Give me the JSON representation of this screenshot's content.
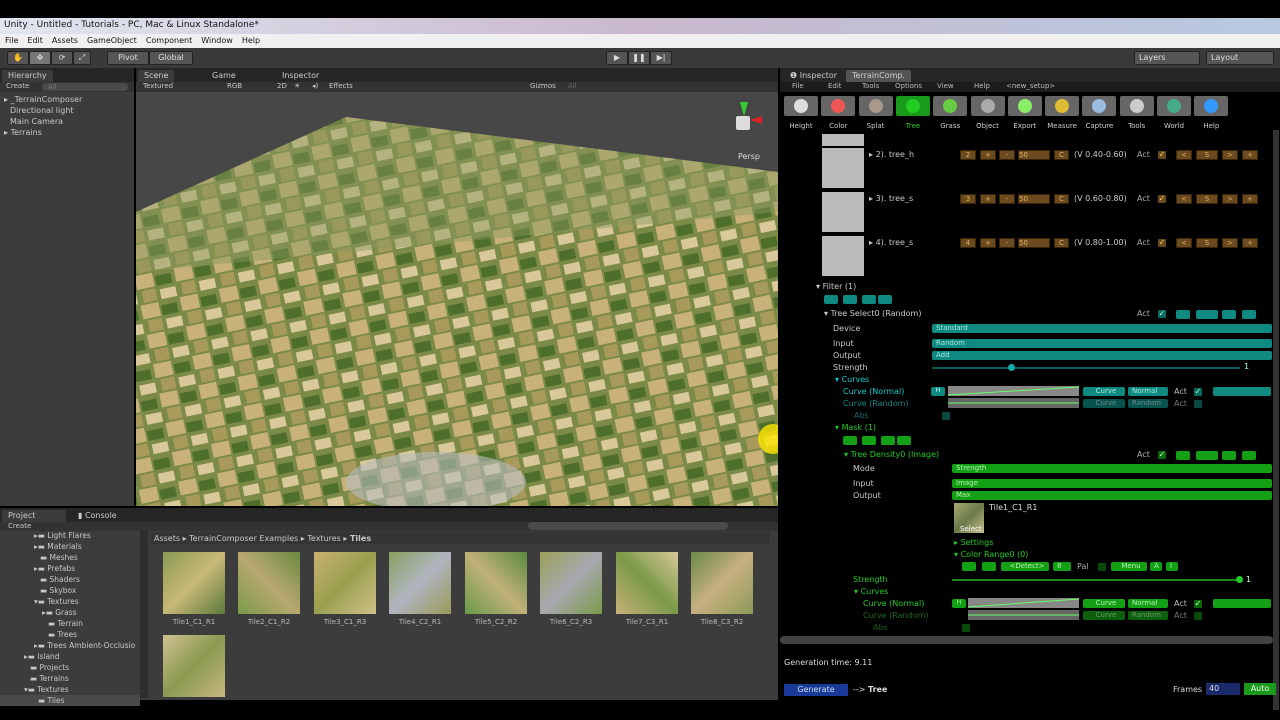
{
  "window": {
    "title": "Unity - Untitled - Tutorials - PC, Mac & Linux Standalone*"
  },
  "menu": [
    "File",
    "Edit",
    "Assets",
    "GameObject",
    "Component",
    "Window",
    "Help"
  ],
  "toolbar": {
    "pivot": "Pivot",
    "global": "Global",
    "layers": "Layers",
    "layout": "Layout"
  },
  "hierarchy": {
    "tab": "Hierarchy",
    "create": "Create",
    "search": "All",
    "items": [
      "_TerrainComposer",
      "Directional light",
      "Main Camera",
      "Terrains"
    ]
  },
  "scene": {
    "tabs": [
      "Scene",
      "Game",
      "Inspector"
    ],
    "shading": "Textured",
    "rgb": "RGB",
    "mode2d": "2D",
    "effects": "Effects",
    "gizmos": "Gizmos",
    "search": "All",
    "persp": "Persp"
  },
  "project": {
    "tabs": [
      "Project",
      "Console"
    ],
    "create": "Create",
    "folders": [
      "Light Flares",
      "Materials",
      "Meshes",
      "Prefabs",
      "Shaders",
      "Skybox",
      "Textures",
      "Grass",
      "Terrain",
      "Trees",
      "Trees Ambient-Occlusio",
      "Island",
      "Projects",
      "Terrains",
      "Textures",
      "Tiles"
    ],
    "breadcrumb": [
      "Assets",
      "TerrainComposer Examples",
      "Textures",
      "Tiles"
    ],
    "assets": [
      "Tile1_C1_R1",
      "Tile2_C1_R2",
      "Tile3_C1_R3",
      "Tile4_C2_R1",
      "Tile5_C2_R2",
      "Tile6_C2_R3",
      "Tile7_C3_R1",
      "Tile8_C3_R2"
    ]
  },
  "tc": {
    "tabs": [
      "Inspector",
      "TerrainComp."
    ],
    "menu": [
      "File",
      "Edit",
      "Tools",
      "Options",
      "View",
      "Help",
      "<new_setup>"
    ],
    "modes": [
      "Height",
      "Color",
      "Splat",
      "Tree",
      "Grass",
      "Object",
      "Export",
      "Measure",
      "Capture",
      "Tools",
      "World",
      "Help"
    ],
    "trees": [
      {
        "name": "2). tree_h",
        "idx": "2",
        "val": "50",
        "range": "(V 0.40-0.60)"
      },
      {
        "name": "3). tree_s",
        "idx": "3",
        "val": "50",
        "range": "(V 0.60-0.80)"
      },
      {
        "name": "4). tree_s",
        "idx": "4",
        "val": "50",
        "range": "(V 0.80-1.00)"
      }
    ],
    "act": "Act",
    "filter": {
      "title": "Filter (1)",
      "select": "Tree Select0 (Random)",
      "device_l": "Device",
      "device": "Standard",
      "input_l": "Input",
      "input": "Random",
      "output_l": "Output",
      "output": "Add",
      "strength_l": "Strength",
      "strength": "1",
      "curves": "Curves",
      "curve_n": "Curve (Normal)",
      "curve_r": "Curve (Random)",
      "abs": "Abs",
      "curve": "Curve",
      "normal": "Normal",
      "random": "Random",
      "h": "H"
    },
    "mask": {
      "title": "Mask (1)",
      "density": "Tree Density0 (Image)",
      "mode_l": "Mode",
      "mode": "Strength",
      "input_l": "Input",
      "input": "Image",
      "output_l": "Output",
      "output": "Max",
      "image": "Tile1_C1_R1",
      "select": "Select",
      "settings": "Settings",
      "color_range": "Color Range0 (0)",
      "detect": "<Detect>",
      "num": "8",
      "pal": "Pal",
      "menu": "Menu",
      "a": "A",
      "i": "I",
      "strength_l": "Strength",
      "strength": "1",
      "curves": "Curves",
      "curve_n": "Curve (Normal)",
      "curve_r": "Curve (Random)",
      "abs": "Abs"
    },
    "gen_time": "Generation time: 9.11",
    "generate": "Generate",
    "arrow": "-->",
    "target": "Tree",
    "frames_l": "Frames",
    "frames": "40",
    "auto": "Auto"
  }
}
